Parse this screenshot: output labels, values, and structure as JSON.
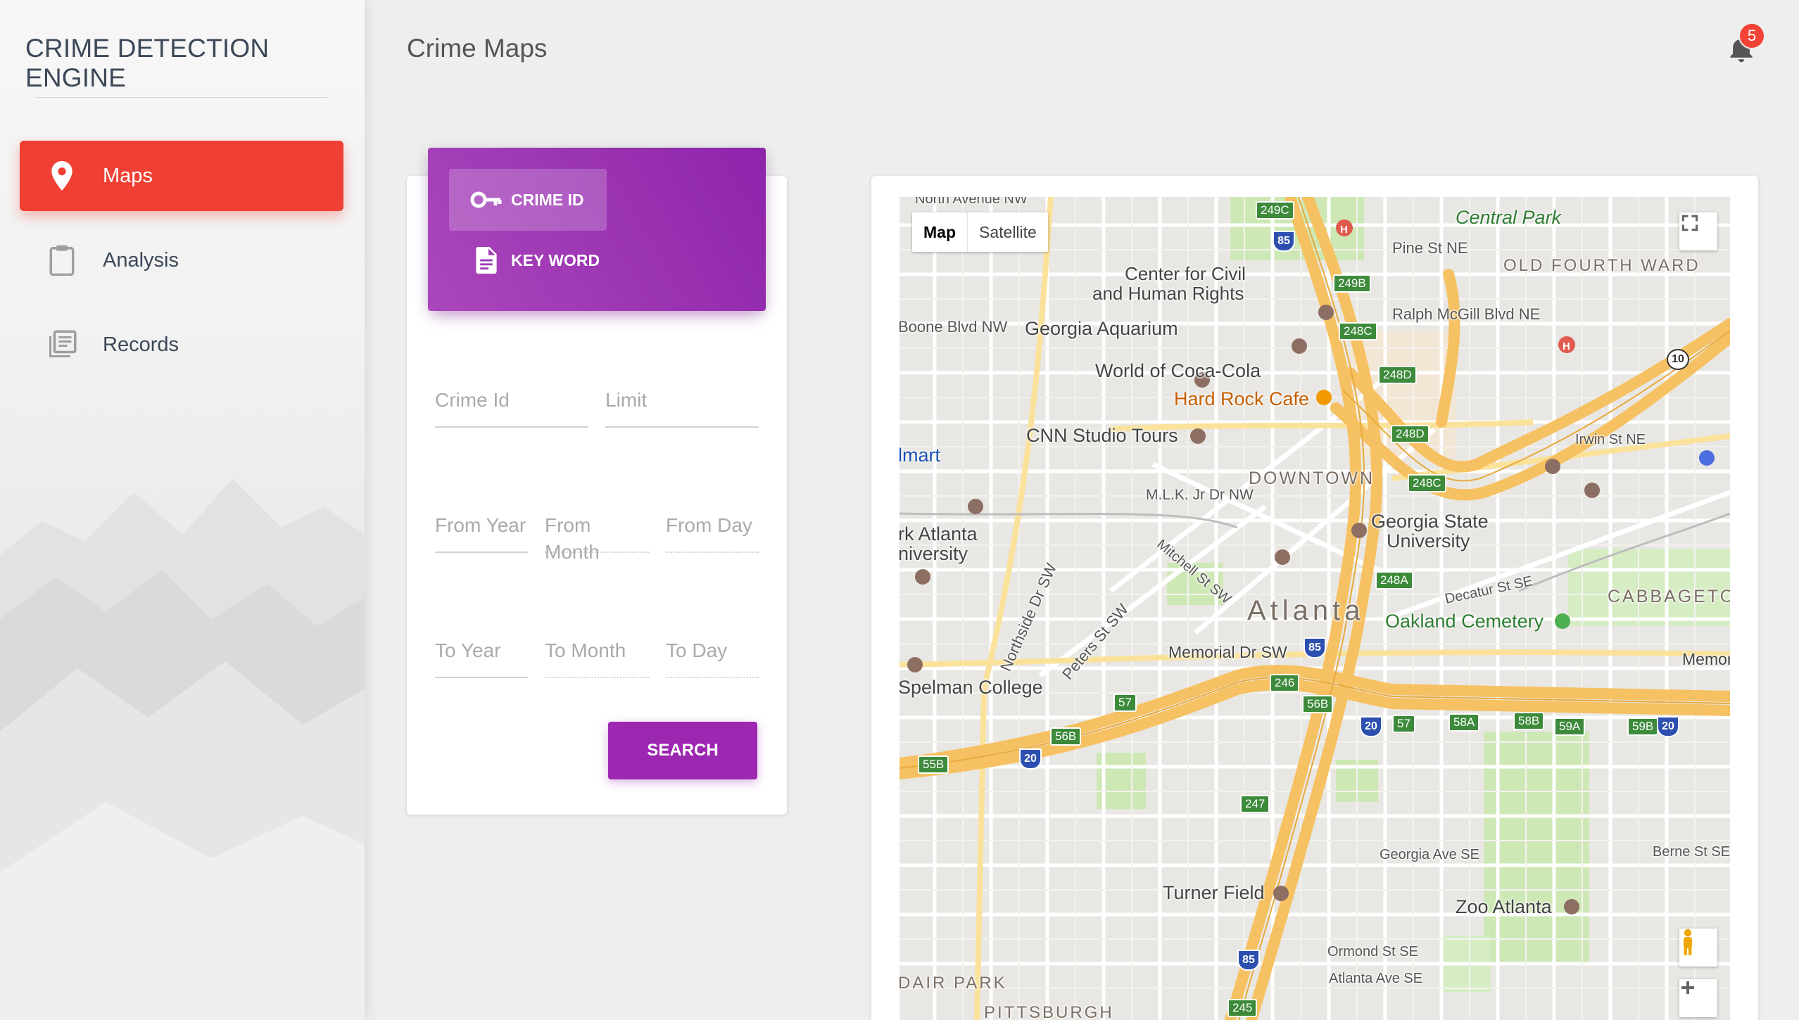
{
  "sidebar": {
    "brand": "CRIME DETECTION ENGINE",
    "items": [
      {
        "label": "Maps",
        "icon": "location-pin-icon",
        "active": true
      },
      {
        "label": "Analysis",
        "icon": "clipboard-icon",
        "active": false
      },
      {
        "label": "Records",
        "icon": "library-books-icon",
        "active": false
      }
    ]
  },
  "header": {
    "title": "Crime Maps",
    "notification_count": "5"
  },
  "search": {
    "tabs": [
      {
        "label": "CRIME ID",
        "icon": "key-icon",
        "active": true
      },
      {
        "label": "KEY WORD",
        "icon": "document-icon",
        "active": false
      }
    ],
    "fields": {
      "crime_id": "Crime Id",
      "limit": "Limit",
      "from_year": "From Year",
      "from_month": "From Month",
      "from_day": "From Day",
      "to_year": "To Year",
      "to_month": "To Month",
      "to_day": "To Day"
    },
    "button_label": "SEARCH"
  },
  "map": {
    "type_options": [
      "Map",
      "Satellite"
    ],
    "selected_type": "Map",
    "labels": {
      "north_ave": "North Avenue NW",
      "central_park": "Central Park",
      "pine_st": "Pine St NE",
      "old_fourth_ward": "OLD FOURTH WARD",
      "civil_rights_1": "Center for Civil",
      "civil_rights_2": "and Human Rights",
      "ralph_mcgill": "Ralph McGill Blvd NE",
      "boone": "Boone Blvd NW",
      "georgia_aquarium": "Georgia Aquarium",
      "coca_cola": "World of Coca-Cola",
      "hard_rock": "Hard Rock Cafe",
      "cnn": "CNN Studio Tours",
      "walmart": "lmart",
      "downtown": "DOWNTOWN",
      "irwin": "Irwin St NE",
      "mlk": "M.L.K. Jr Dr NW",
      "gsu_1": "Georgia State",
      "gsu_2": "University",
      "atl_univ_1": "rk Atlanta",
      "atl_univ_2": "niversity",
      "mitchell": "Mitchell St SW",
      "decatur": "Decatur St SE",
      "cabbagetown": "CABBAGETO",
      "atlanta": "Atlanta",
      "oakland": "Oakland Cemetery",
      "northside": "Northside Dr SW",
      "peters": "Peters St SW",
      "memorial": "Memorial Dr SW",
      "memorial_e": "Memor",
      "spelman": "Spelman College",
      "georgia_ave": "Georgia Ave SE",
      "turner_field": "Turner Field",
      "zoo": "Zoo Atlanta",
      "ormond": "Ormond St SE",
      "atlanta_ave": "Atlanta Ave SE",
      "berne": "Berne St SE",
      "adair_park": "DAIR PARK",
      "pittsburgh": "PITTSBURGH"
    },
    "exit_shields": [
      "249C",
      "249B",
      "248C",
      "248D",
      "248D",
      "248C",
      "248A",
      "246",
      "56B",
      "57",
      "58A",
      "58B",
      "59A",
      "59B",
      "57",
      "56B",
      "55B",
      "247",
      "245"
    ],
    "interstates": [
      "85",
      "85",
      "20",
      "20",
      "20",
      "85",
      "10"
    ]
  },
  "colors": {
    "accent_red": "#f04033",
    "accent_purple": "#9c27b0",
    "map_highway": "#f6c162"
  }
}
